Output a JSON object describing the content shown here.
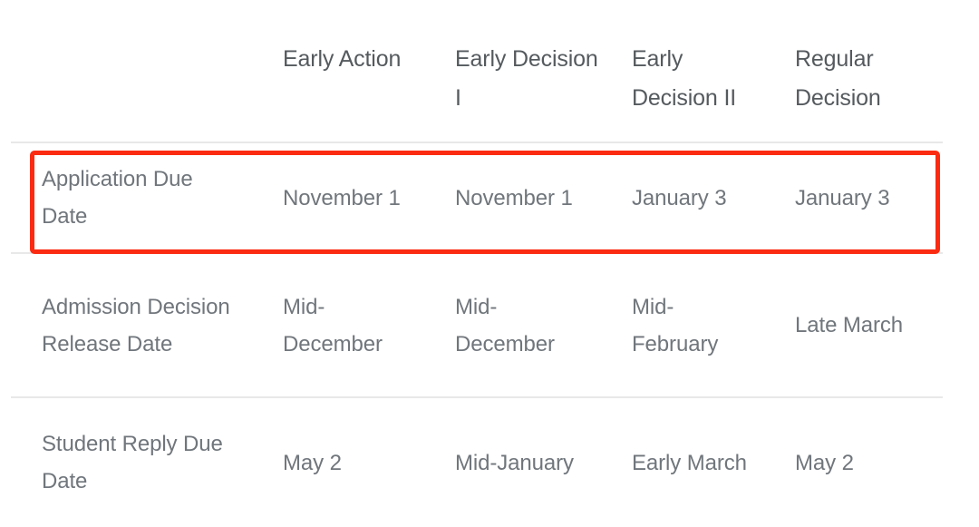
{
  "table": {
    "corner_label": "",
    "column_headers": [
      "Early Action",
      "Early Decision I",
      "Early Decision II",
      "Regular Decision"
    ],
    "rows": [
      {
        "label": "Application Due Date",
        "values": [
          "November 1",
          "November 1",
          "January 3",
          "January 3"
        ],
        "highlighted": true
      },
      {
        "label": "Admission Decision Release Date",
        "values": [
          "Mid-December",
          "Mid-December",
          "Mid-February",
          "Late March"
        ],
        "highlighted": false
      },
      {
        "label": "Student Reply Due Date",
        "values": [
          "May 2",
          "Mid-January",
          "Early March",
          "May 2"
        ],
        "highlighted": false
      }
    ]
  },
  "annotation": {
    "highlight_color": "#fb2b12",
    "target_row_label": "Application Due Date"
  },
  "colors": {
    "header_text": "#555a5e",
    "body_text": "#70767c",
    "rule": "#e8e8e8",
    "background": "#ffffff"
  }
}
